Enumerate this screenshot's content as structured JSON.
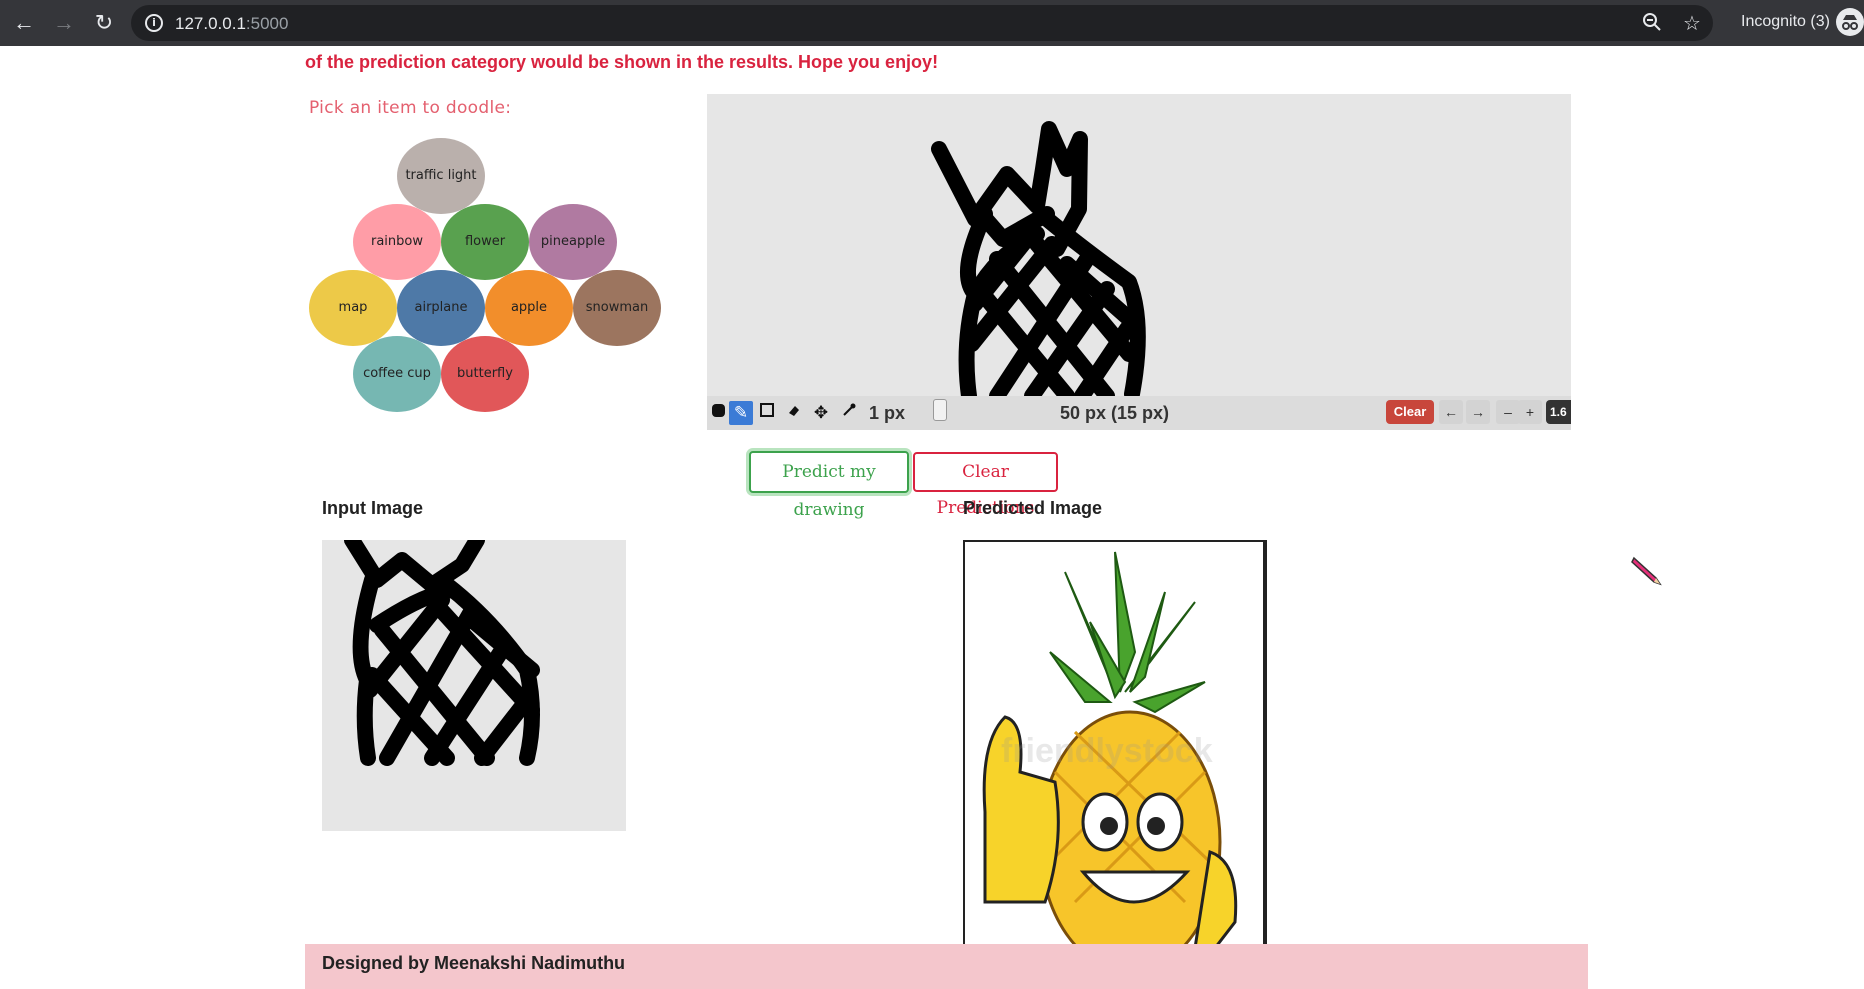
{
  "browser": {
    "url_host": "127.0.0.1",
    "url_port": ":5000",
    "incognito_label": "Incognito (3)",
    "icons": [
      "back-arrow-icon",
      "forward-arrow-icon",
      "reload-icon",
      "info-icon",
      "zoom-icon",
      "star-icon",
      "incognito-icon"
    ]
  },
  "page": {
    "intro_text": "of the prediction category would be shown in the results. Hope you enjoy!",
    "pick_label": "Pick an item to doodle:",
    "items": [
      {
        "label": "traffic light",
        "color": "#bab0ac"
      },
      {
        "label": "rainbow",
        "color": "#ff9da7"
      },
      {
        "label": "flower",
        "color": "#59a14f"
      },
      {
        "label": "pineapple",
        "color": "#b07aa1"
      },
      {
        "label": "map",
        "color": "#edc948"
      },
      {
        "label": "airplane",
        "color": "#4e79a7"
      },
      {
        "label": "apple",
        "color": "#f28e2b"
      },
      {
        "label": "snowman",
        "color": "#9c755f"
      },
      {
        "label": "coffee cup",
        "color": "#76b7b2"
      },
      {
        "label": "butterfly",
        "color": "#e15759"
      }
    ],
    "canvas": {
      "stroke_width_label": "1 px",
      "brush_size_label": "50 px (15 px)",
      "clear_label": "Clear",
      "undo_label": "←",
      "redo_label": "→",
      "zoom_out_label": "–",
      "zoom_in_label": "+",
      "zoom_readout": "1.6",
      "tools": [
        "color-swatch-icon",
        "pencil-icon",
        "rectangle-icon",
        "eraser-icon",
        "move-icon",
        "eyedropper-icon"
      ],
      "active_tool": "pencil-icon"
    },
    "predict_button": "Predict my drawing",
    "clear_predictions_button": "Clear Predictions",
    "input_heading": "Input Image",
    "predicted_heading": "Predicted Image",
    "watermark": "friendlystock",
    "footer": "Designed by Meenakshi Nadimuthu"
  },
  "colors": {
    "accent_red": "#d9233f",
    "accent_green": "#3ca24c",
    "footer_bg": "#f4c6cc",
    "canvas_bg": "#e6e6e6"
  }
}
